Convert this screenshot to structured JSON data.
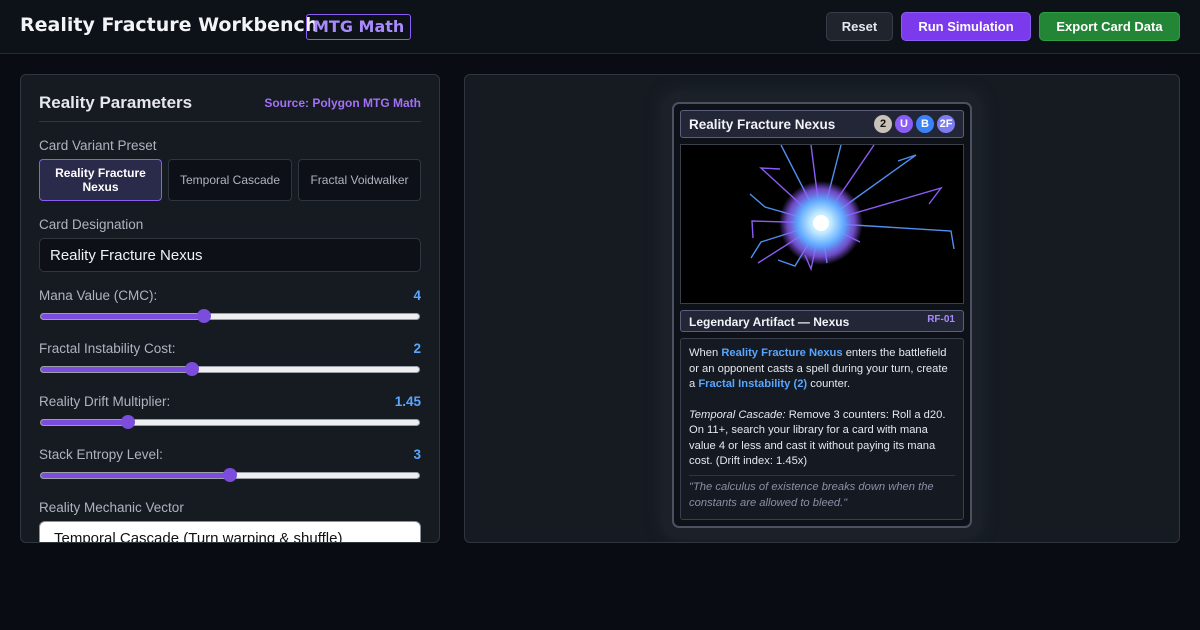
{
  "header": {
    "title": "Reality Fracture Workbench",
    "badge": "MTG Math",
    "buttons": {
      "reset": "Reset",
      "run": "Run Simulation",
      "export": "Export Card Data"
    }
  },
  "params": {
    "title": "Reality Parameters",
    "source": "Source: Polygon MTG Math",
    "preset_label": "Card Variant Preset",
    "presets": [
      {
        "label": "Reality Fracture Nexus",
        "active": true
      },
      {
        "label": "Temporal Cascade",
        "active": false
      },
      {
        "label": "Fractal Voidwalker",
        "active": false
      }
    ],
    "designation_label": "Card Designation",
    "designation_value": "Reality Fracture Nexus",
    "sliders": [
      {
        "label": "Mana Value (CMC):",
        "value": "4",
        "fraction": 0.43
      },
      {
        "label": "Fractal Instability Cost:",
        "value": "2",
        "fraction": 0.4
      },
      {
        "label": "Reality Drift Multiplier:",
        "value": "1.45",
        "fraction": 0.23
      },
      {
        "label": "Stack Entropy Level:",
        "value": "3",
        "fraction": 0.5
      }
    ],
    "mechanic_label": "Reality Mechanic Vector",
    "mechanic_value": "Temporal Cascade (Turn warping & shuffle)"
  },
  "card": {
    "name": "Reality Fracture Nexus",
    "mana": [
      {
        "symbol": "2",
        "color": "#c9c2b8",
        "text": "#111111"
      },
      {
        "symbol": "U",
        "color": "#8b5cf6",
        "text": "#ffffff"
      },
      {
        "symbol": "B",
        "color": "#3b82f6",
        "text": "#ffffff"
      },
      {
        "symbol": "2F",
        "color": "#7c7cf0",
        "text": "#ffffff"
      }
    ],
    "type_line": "Legendary Artifact — Nexus",
    "set_code": "RF-01",
    "rules": {
      "p1_a": "When ",
      "p1_kw1": "Reality Fracture Nexus",
      "p1_b": " enters the battlefield or an opponent casts a spell during your turn, create a ",
      "p1_kw2": "Fractal Instability (2)",
      "p1_c": " counter.",
      "p2_ability": "Temporal Cascade:",
      "p2_text": " Remove 3 counters: Roll a d20. On 11+, search your library for a card with mana value 4 or less and cast it without paying its mana cost. (Drift index: 1.45x)"
    },
    "flavor": "\"The calculus of existence breaks down when the constants are allowed to bleed.\""
  },
  "colors": {
    "accent": "#8b5cf6",
    "success": "#238636",
    "link": "#58a6ff"
  }
}
